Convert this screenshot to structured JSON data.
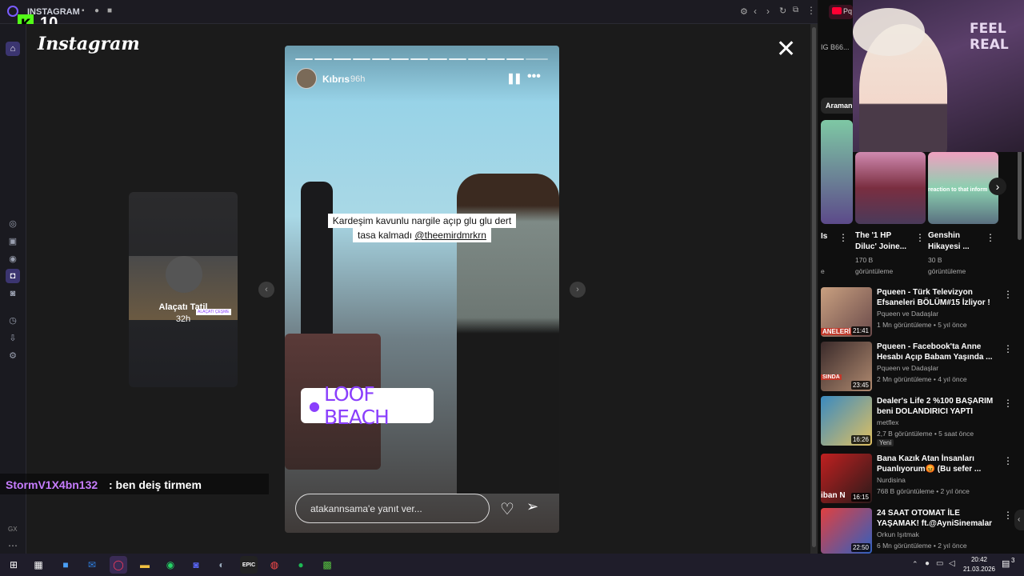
{
  "browser": {
    "tab_title": "INSTAGRAM",
    "right_tab_label": "Pq",
    "url_fragment": "IG B66..."
  },
  "overlay": {
    "kick_count": "10"
  },
  "instagram": {
    "logo": "Instagram",
    "prev_story": {
      "label": "Alaçatı Tatil",
      "time": "32h",
      "badge": "ALAÇATI ÇEŞME"
    },
    "story": {
      "username": "Kıbrıs",
      "time": "96h",
      "caption_line1": "Kardeşim kavunlu nargile açıp glu glu dert",
      "caption_line2": "tasa kalmadı",
      "mention": "@theemirdmrkrn",
      "location": "LOOF BEACH",
      "reply_placeholder": "atakannsama'e yanıt ver..."
    }
  },
  "chat": {
    "user": "StormV1X4bn132",
    "message": ": ben deiş tirmem"
  },
  "youtube": {
    "search_chip": "Araman",
    "shorts": [
      {
        "title": "Is",
        "views": "",
        "meta": "e"
      },
      {
        "title": "The '1 HP Diluc' Joine...",
        "views": "170 B",
        "meta": "görüntüleme"
      },
      {
        "title": "Genshin Hikayesi ...",
        "views": "30 B",
        "meta": "görüntüleme"
      }
    ],
    "shorts_thumb_text": "reaction to that inform",
    "feel_real": "FEEL REAL",
    "videos": [
      {
        "title": "Pqueen - Türk Televizyon Efsaneleri BÖLÜM#15 İzliyor !",
        "channel": "Pqueen ve Dadaşlar",
        "meta": "1 Mn görüntüleme • 5 yıl önce",
        "duration": "21:41",
        "thumb_text": "ANELERİ",
        "badge": ""
      },
      {
        "title": "Pqueen - Facebook'ta Anne Hesabı Açıp Babam Yaşında ...",
        "channel": "Pqueen ve Dadaşlar",
        "meta": "2 Mn görüntüleme • 4 yıl önce",
        "duration": "23:45",
        "thumb_text": "SINDA",
        "badge": ""
      },
      {
        "title": "Dealer's Life 2 %100 BAŞARIM beni DOLANDIRICI YAPTI",
        "channel": "metflex",
        "meta": "2,7 B görüntüleme • 5 saat önce",
        "duration": "16:26",
        "thumb_text": "",
        "badge": "Yeni"
      },
      {
        "title": "Bana Kazık Atan İnsanları Puanlıyorum😡 (Bu sefer ...",
        "channel": "Nurdisina",
        "meta": "768 B görüntüleme • 2 yıl önce",
        "duration": "16:15",
        "thumb_text": "iban N",
        "badge": ""
      },
      {
        "title": "24 SAAT OTOMAT İLE YAŞAMAK! ft.@AyniSinemalar",
        "channel": "Orkun Işıtmak",
        "meta": "6 Mn görüntüleme • 2 yıl önce",
        "duration": "22:50",
        "thumb_text": "",
        "badge": ""
      }
    ]
  },
  "taskbar": {
    "time": "20:42",
    "date": "21.03.2026",
    "notif": "3"
  },
  "sidebar": {
    "gx": "GX"
  },
  "colors": {
    "accent": "#8a3ffc",
    "chat_user": "#c77dff"
  }
}
